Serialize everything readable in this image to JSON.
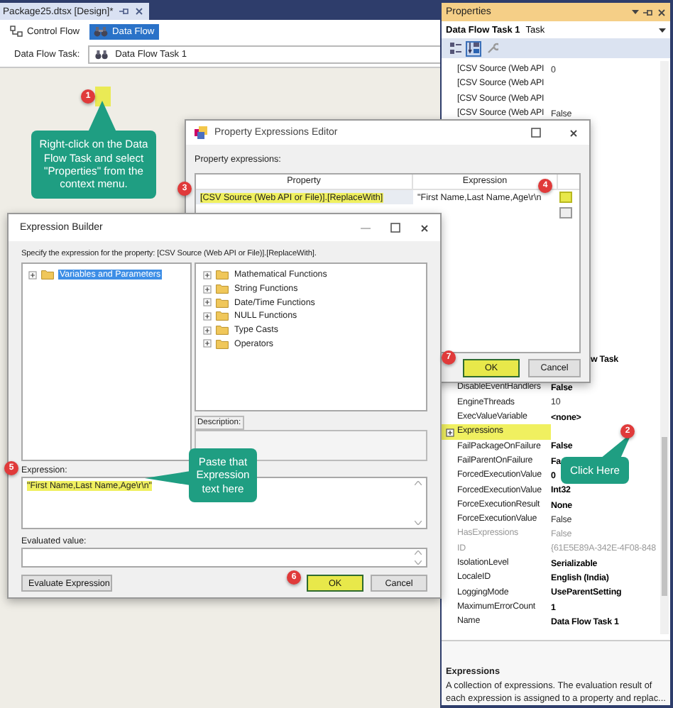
{
  "document_tab": {
    "label": "Package25.dtsx [Design]*"
  },
  "designer": {
    "tabs": [
      {
        "label": "Control Flow",
        "selected": false
      },
      {
        "label": "Data Flow",
        "selected": true
      }
    ],
    "task_label": "Data Flow Task:",
    "task_value": "Data Flow Task 1"
  },
  "properties": {
    "title": "Properties",
    "object_name": "Data Flow Task 1",
    "object_type": "Task",
    "toolbar": [
      {
        "kind": "categorized",
        "selected": false
      },
      {
        "kind": "alphabetical",
        "selected": true
      },
      {
        "kind": "pages",
        "selected": false
      }
    ],
    "rows": [
      {
        "kind": "property",
        "name": "[CSV Source (Web API",
        "value": "0",
        "modified": false,
        "disabled": false,
        "highlighted": false,
        "expandable": false
      },
      {
        "kind": "property",
        "name": "[CSV Source (Web API",
        "disabled": false,
        "highlighted": false,
        "expandable": false
      },
      {
        "kind": "property",
        "name": "[CSV Source (Web API",
        "disabled": false,
        "highlighted": false,
        "expandable": false
      },
      {
        "kind": "property",
        "name": "[CSV Source (Web API",
        "value": "False",
        "modified": false,
        "disabled": false,
        "highlighted": false,
        "expandable": false
      },
      {
        "kind": "partial",
        "value": "w Task",
        "modified": true,
        "disabled": false,
        "highlighted": false,
        "expandable": false
      },
      {
        "kind": "property",
        "name": "DisableEventHandlers",
        "value": "False",
        "modified": true,
        "disabled": false,
        "highlighted": false,
        "expandable": false
      },
      {
        "kind": "property",
        "name": "EngineThreads",
        "value": "10",
        "modified": false,
        "disabled": false,
        "highlighted": false,
        "expandable": false
      },
      {
        "kind": "property",
        "name": "ExecValueVariable",
        "value": "<none>",
        "modified": true,
        "disabled": false,
        "highlighted": false,
        "expandable": false
      },
      {
        "kind": "property",
        "name": "Expressions",
        "disabled": false,
        "highlighted": true,
        "expandable": true
      },
      {
        "kind": "property",
        "name": "FailPackageOnFailure",
        "value": "False",
        "modified": true,
        "disabled": false,
        "highlighted": false,
        "expandable": false
      },
      {
        "kind": "property",
        "name": "FailParentOnFailure",
        "value": "Fa",
        "modified": true,
        "disabled": false,
        "highlighted": false,
        "expandable": false
      },
      {
        "kind": "property",
        "name": "ForcedExecutionValue",
        "value": "0",
        "modified": true,
        "disabled": false,
        "highlighted": false,
        "expandable": false
      },
      {
        "kind": "property",
        "name": "ForcedExecutionValue",
        "value": "Int32",
        "modified": true,
        "disabled": false,
        "highlighted": false,
        "expandable": false
      },
      {
        "kind": "property",
        "name": "ForceExecutionResult",
        "value": "None",
        "modified": true,
        "disabled": false,
        "highlighted": false,
        "expandable": false
      },
      {
        "kind": "property",
        "name": "ForceExecutionValue",
        "value": "False",
        "modified": false,
        "disabled": false,
        "highlighted": false,
        "expandable": false
      },
      {
        "kind": "property",
        "name": "HasExpressions",
        "value": "False",
        "modified": false,
        "disabled": true,
        "highlighted": false,
        "expandable": false
      },
      {
        "kind": "property",
        "name": "ID",
        "value": "{61E5E89A-342E-4F08-848",
        "modified": false,
        "disabled": true,
        "highlighted": false,
        "expandable": false
      },
      {
        "kind": "property",
        "name": "IsolationLevel",
        "value": "Serializable",
        "modified": true,
        "disabled": false,
        "highlighted": false,
        "expandable": false
      },
      {
        "kind": "property",
        "name": "LocaleID",
        "value": "English (India)",
        "modified": true,
        "disabled": false,
        "highlighted": false,
        "expandable": false
      },
      {
        "kind": "property",
        "name": "LoggingMode",
        "value": "UseParentSetting",
        "modified": true,
        "disabled": false,
        "highlighted": false,
        "expandable": false
      },
      {
        "kind": "property",
        "name": "MaximumErrorCount",
        "value": "1",
        "modified": true,
        "disabled": false,
        "highlighted": false,
        "expandable": false
      },
      {
        "kind": "property",
        "name": "Name",
        "value": "Data Flow Task 1",
        "modified": true,
        "disabled": false,
        "highlighted": false,
        "expandable": false
      }
    ],
    "description_title": "Expressions",
    "description": "A collection of expressions. The evaluation result of each expression is assigned to a property and replac..."
  },
  "property_expressions_editor": {
    "title": "Property Expressions Editor",
    "list_label": "Property expressions:",
    "columns": [
      "Property",
      "Expression"
    ],
    "rows": [
      {
        "property": "[CSV Source (Web API or File)].[ReplaceWith]",
        "expression": "\"First Name,Last Name,Age\\r\\n",
        "highlighted": true
      }
    ],
    "buttons": [
      {
        "label": "OK",
        "highlighted": true
      },
      {
        "label": "Cancel",
        "highlighted": false
      }
    ]
  },
  "expression_builder": {
    "title": "Expression Builder",
    "prompt": "Specify the expression for the property: [CSV Source (Web API or File)].[ReplaceWith].",
    "variables_tree": [
      {
        "label": "Variables and Parameters",
        "selected": true
      }
    ],
    "functions_tree": [
      {
        "label": "Mathematical Functions",
        "selected": false
      },
      {
        "label": "String Functions",
        "selected": false
      },
      {
        "label": "Date/Time Functions",
        "selected": false
      },
      {
        "label": "NULL Functions",
        "selected": false
      },
      {
        "label": "Type Casts",
        "selected": false
      },
      {
        "label": "Operators",
        "selected": false
      }
    ],
    "description_label": "Description:",
    "expression_label": "Expression:",
    "expression": "\"First Name,Last Name,Age\\r\\n\"",
    "expression_highlighted": true,
    "evaluated_label": "Evaluated value:",
    "buttons": [
      {
        "label": "Evaluate Expression",
        "highlighted": false
      },
      {
        "label": "OK",
        "highlighted": true
      },
      {
        "label": "Cancel",
        "highlighted": false
      }
    ]
  },
  "callouts": [
    {
      "text": "Right-click on the Data Flow Task and select \"Properties\" from the context menu."
    },
    {
      "text": "Click Here"
    },
    {
      "text": "Paste that Expression text here"
    }
  ],
  "steps": [
    "1",
    "2",
    "3",
    "4",
    "5",
    "6",
    "7"
  ]
}
